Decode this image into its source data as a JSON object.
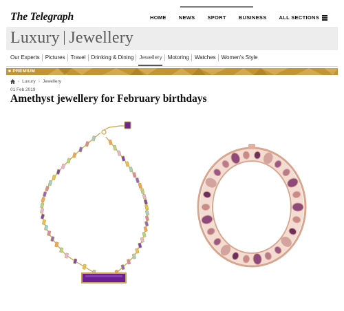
{
  "brand": {
    "logo": "The Telegraph"
  },
  "topnav": {
    "items": [
      {
        "label": "HOME"
      },
      {
        "label": "NEWS"
      },
      {
        "label": "SPORT"
      },
      {
        "label": "BUSINESS"
      },
      {
        "label": "ALL SECTIONS"
      }
    ]
  },
  "section": {
    "left": "Luxury",
    "right": "Jewellery"
  },
  "subnav": {
    "items": [
      {
        "label": "Our Experts"
      },
      {
        "label": "Pictures"
      },
      {
        "label": "Travel"
      },
      {
        "label": "Drinking & Dining"
      },
      {
        "label": "Jewellery"
      },
      {
        "label": "Motoring"
      },
      {
        "label": "Watches"
      },
      {
        "label": "Women's Style"
      }
    ],
    "active": "Jewellery"
  },
  "premium": {
    "label": "PREMIUM",
    "color": "#c19434"
  },
  "breadcrumb": {
    "items": [
      "Luxury",
      "Jewellery"
    ]
  },
  "article": {
    "date": "01 Feb 2019",
    "headline": "Amethyst jewellery for February birthdays"
  },
  "icons": {
    "home": "home-icon",
    "menu": "hamburger-icon"
  }
}
